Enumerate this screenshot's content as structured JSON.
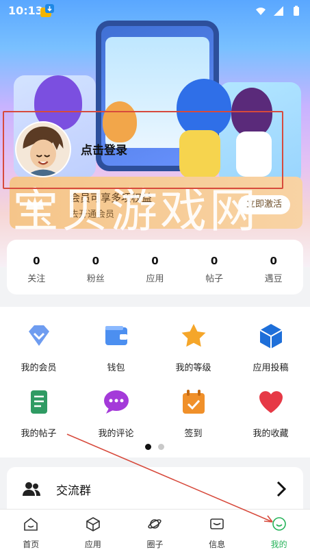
{
  "status_bar": {
    "time": "10:13"
  },
  "login": {
    "label": "点击登录"
  },
  "vip": {
    "title": "会员可享多项权益",
    "subtitle": "去开通会员",
    "button": "立即激活"
  },
  "watermark": "宝贝游戏网",
  "stats": [
    {
      "value": "0",
      "label": "关注"
    },
    {
      "value": "0",
      "label": "粉丝"
    },
    {
      "value": "0",
      "label": "应用"
    },
    {
      "value": "0",
      "label": "帖子"
    },
    {
      "value": "0",
      "label": "遇豆"
    }
  ],
  "features": [
    {
      "label": "我的会员",
      "icon": "diamond-icon"
    },
    {
      "label": "钱包",
      "icon": "wallet-icon"
    },
    {
      "label": "我的等级",
      "icon": "star-icon"
    },
    {
      "label": "应用投稿",
      "icon": "cube-icon"
    },
    {
      "label": "我的帖子",
      "icon": "scroll-icon"
    },
    {
      "label": "我的评论",
      "icon": "chat-bubble-icon"
    },
    {
      "label": "签到",
      "icon": "calendar-check-icon"
    },
    {
      "label": "我的收藏",
      "icon": "heart-icon"
    }
  ],
  "pager": {
    "pages": 2,
    "active": 1
  },
  "group": {
    "label": "交流群"
  },
  "tabbar": [
    {
      "label": "首页",
      "icon": "home-icon"
    },
    {
      "label": "应用",
      "icon": "box-icon"
    },
    {
      "label": "圈子",
      "icon": "planet-icon"
    },
    {
      "label": "信息",
      "icon": "message-icon"
    },
    {
      "label": "我的",
      "icon": "smile-icon",
      "active": true
    }
  ],
  "colors": {
    "accent_green": "#26b35a",
    "annotation_red": "#d74a3c",
    "vip_gold": "#f5c58a"
  }
}
